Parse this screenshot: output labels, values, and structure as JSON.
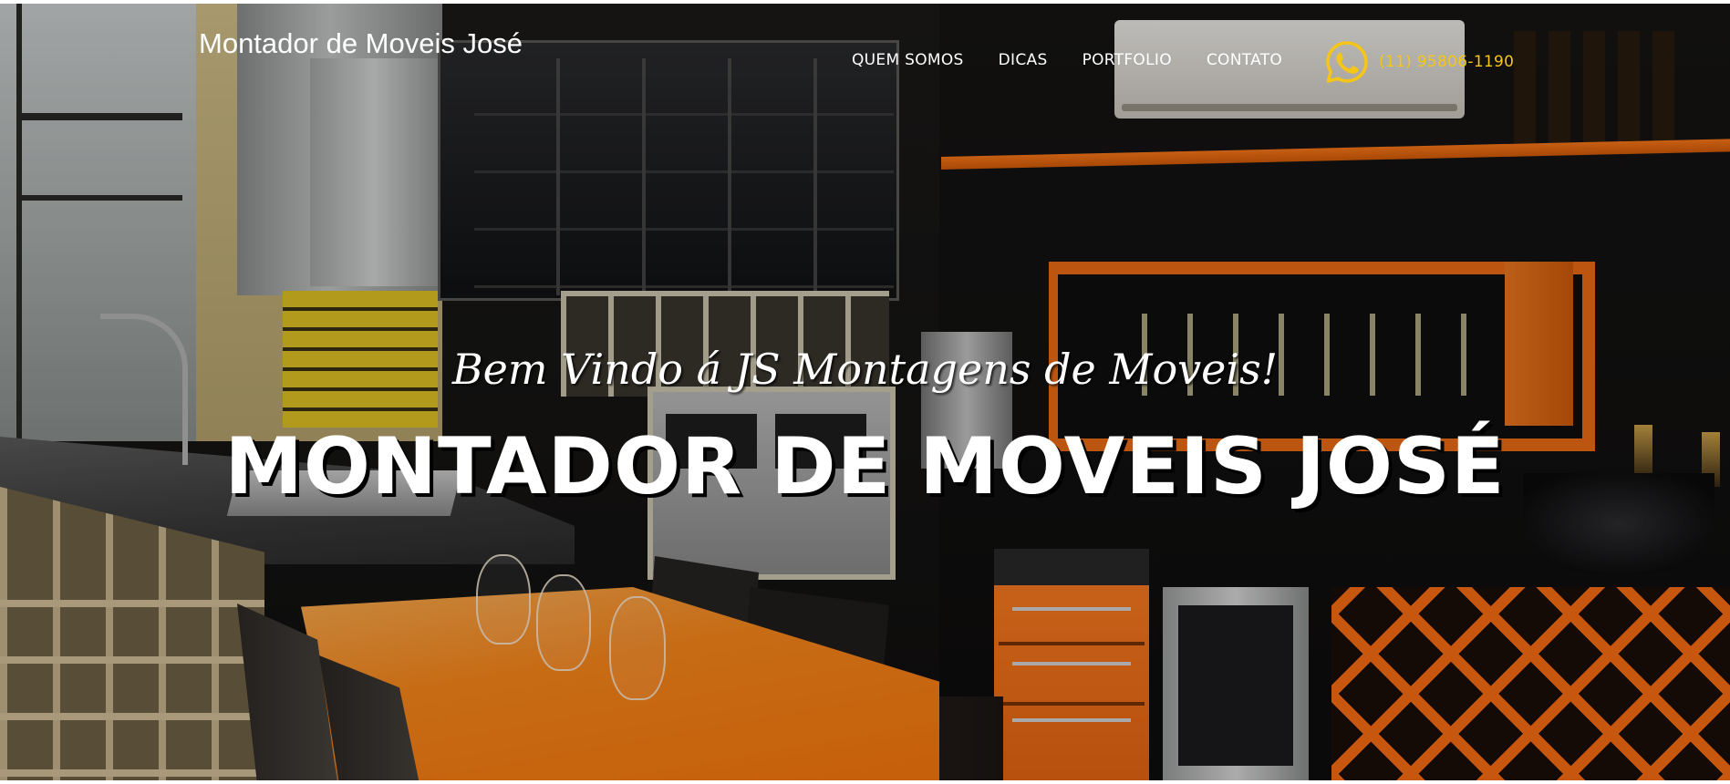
{
  "header": {
    "brand": "Montador de Moveis José",
    "nav": [
      {
        "label": "QUEM SOMOS"
      },
      {
        "label": "DICAS"
      },
      {
        "label": "PORTFOLIO"
      },
      {
        "label": "CONTATO"
      }
    ],
    "phone": {
      "icon": "whatsapp-icon",
      "number": "(11) 95806-1190",
      "color": "#f5c518"
    }
  },
  "hero": {
    "welcome": "Bem Vindo á JS Montagens de Moveis!",
    "headline": "MONTADOR DE MOVEIS JOSÉ",
    "background_image": "kitchen interior with orange table and orange wine rack"
  },
  "colors": {
    "accent": "#f5c518",
    "text": "#ffffff"
  }
}
